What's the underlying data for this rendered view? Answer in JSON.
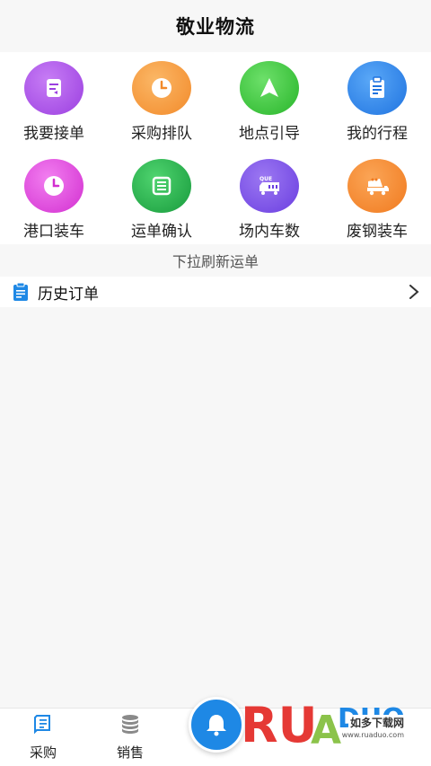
{
  "header": {
    "title": "敬业物流"
  },
  "grid": [
    {
      "label": "我要接单",
      "icon": "order-accept-icon",
      "color": "#a855e8"
    },
    {
      "label": "采购排队",
      "icon": "clock-icon",
      "color": "#f79a3c"
    },
    {
      "label": "地点引导",
      "icon": "navigation-arrow-icon",
      "color": "#3cc83c"
    },
    {
      "label": "我的行程",
      "icon": "clipboard-icon",
      "color": "#2f86f0"
    },
    {
      "label": "港口装车",
      "icon": "clock-icon",
      "color": "#e040d8"
    },
    {
      "label": "运单确认",
      "icon": "document-confirm-icon",
      "color": "#22b04a"
    },
    {
      "label": "场内车数",
      "icon": "truck-queue-icon",
      "color": "#7a4ee6"
    },
    {
      "label": "废钢装车",
      "icon": "dump-truck-icon",
      "color": "#f7882e"
    }
  ],
  "pull_tip": "下拉刷新运单",
  "history": {
    "label": "历史订单",
    "icon": "document-icon"
  },
  "tabbar": {
    "tabs": [
      {
        "label": "采购",
        "icon": "purchase-book-icon"
      },
      {
        "label": "销售",
        "icon": "database-stack-icon"
      }
    ],
    "fab_icon": "bell-icon"
  },
  "watermark": {
    "text": "如多下载网",
    "url": "www.ruaduo.com"
  },
  "colors": {
    "accent": "#1e88e5",
    "background": "#f7f7f7"
  }
}
